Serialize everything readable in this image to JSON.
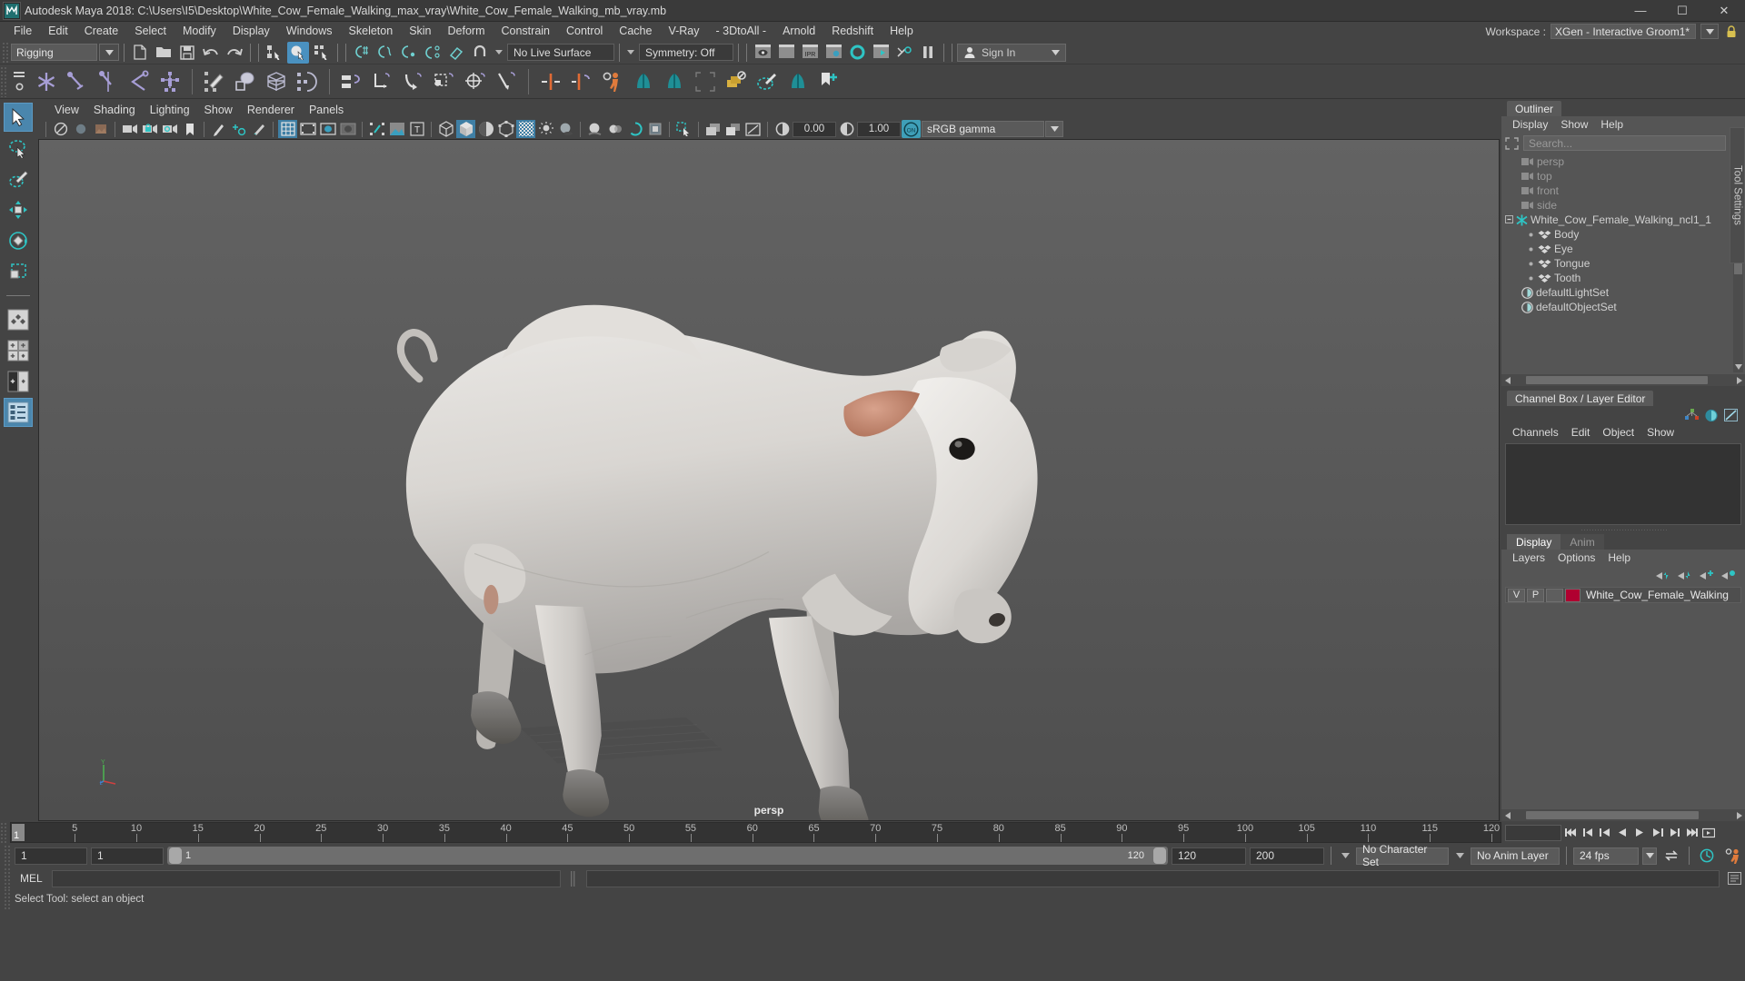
{
  "window": {
    "title": "Autodesk Maya 2018: C:\\Users\\I5\\Desktop\\White_Cow_Female_Walking_max_vray\\White_Cow_Female_Walking_mb_vray.mb",
    "minimize": "—",
    "maximize": "☐",
    "close": "✕"
  },
  "menubar": {
    "items": [
      {
        "label": "File"
      },
      {
        "label": "Edit"
      },
      {
        "label": "Create"
      },
      {
        "label": "Select"
      },
      {
        "label": "Modify"
      },
      {
        "label": "Display"
      },
      {
        "label": "Windows"
      },
      {
        "label": "Skeleton"
      },
      {
        "label": "Skin"
      },
      {
        "label": "Deform"
      },
      {
        "label": "Constrain"
      },
      {
        "label": "Control"
      },
      {
        "label": "Cache"
      },
      {
        "label": "V-Ray"
      },
      {
        "label": "- 3DtoAll -"
      },
      {
        "label": "Arnold"
      },
      {
        "label": "Redshift"
      },
      {
        "label": "Help"
      }
    ],
    "workspace_label": "Workspace :",
    "workspace_value": "XGen - Interactive Groom1*"
  },
  "statusline": {
    "menuset": "Rigging",
    "live_surface": "No Live Surface",
    "symmetry": "Symmetry: Off",
    "signin": "Sign In"
  },
  "viewport_menu": {
    "items": [
      {
        "label": "View"
      },
      {
        "label": "Shading"
      },
      {
        "label": "Lighting"
      },
      {
        "label": "Show"
      },
      {
        "label": "Renderer"
      },
      {
        "label": "Panels"
      }
    ]
  },
  "viewport_toolbar": {
    "exposure": "0.00",
    "gamma_value": "1.00",
    "color_profile": "sRGB gamma",
    "view_label": "persp"
  },
  "outliner": {
    "tab": "Outliner",
    "menu": [
      {
        "label": "Display"
      },
      {
        "label": "Show"
      },
      {
        "label": "Help"
      }
    ],
    "search_placeholder": "Search...",
    "items": [
      {
        "label": "persp",
        "icon": "camera-icon",
        "dim": true,
        "indent": 1
      },
      {
        "label": "top",
        "icon": "camera-icon",
        "dim": true,
        "indent": 1
      },
      {
        "label": "front",
        "icon": "camera-icon",
        "dim": true,
        "indent": 1
      },
      {
        "label": "side",
        "icon": "camera-icon",
        "dim": true,
        "indent": 1
      },
      {
        "label": "White_Cow_Female_Walking_ncl1_1",
        "icon": "nucleus-icon",
        "dim": false,
        "indent": 0
      },
      {
        "label": "Body",
        "icon": "mesh-icon",
        "dim": false,
        "indent": 2
      },
      {
        "label": "Eye",
        "icon": "mesh-icon",
        "dim": false,
        "indent": 2
      },
      {
        "label": "Tongue",
        "icon": "mesh-icon",
        "dim": false,
        "indent": 2
      },
      {
        "label": "Tooth",
        "icon": "mesh-icon",
        "dim": false,
        "indent": 2
      },
      {
        "label": "defaultLightSet",
        "icon": "set-icon",
        "dim": false,
        "indent": 1
      },
      {
        "label": "defaultObjectSet",
        "icon": "set-icon",
        "dim": false,
        "indent": 1
      }
    ]
  },
  "channelbox": {
    "tab": "Channel Box / Layer Editor",
    "menu": [
      {
        "label": "Channels"
      },
      {
        "label": "Edit"
      },
      {
        "label": "Object"
      },
      {
        "label": "Show"
      }
    ]
  },
  "layers": {
    "tabs": [
      {
        "label": "Display",
        "active": true
      },
      {
        "label": "Anim",
        "active": false
      }
    ],
    "menu": [
      {
        "label": "Layers"
      },
      {
        "label": "Options"
      },
      {
        "label": "Help"
      }
    ],
    "rows": [
      {
        "visible": "V",
        "playback": "P",
        "third": "",
        "color": "#b00030",
        "name": "White_Cow_Female_Walking"
      }
    ]
  },
  "tool_settings_tab": "Tool Settings",
  "timeline": {
    "ticks": [
      {
        "label": "5",
        "frame": 5
      },
      {
        "label": "10",
        "frame": 10
      },
      {
        "label": "15",
        "frame": 15
      },
      {
        "label": "20",
        "frame": 20
      },
      {
        "label": "25",
        "frame": 25
      },
      {
        "label": "30",
        "frame": 30
      },
      {
        "label": "35",
        "frame": 35
      },
      {
        "label": "40",
        "frame": 40
      },
      {
        "label": "45",
        "frame": 45
      },
      {
        "label": "50",
        "frame": 50
      },
      {
        "label": "55",
        "frame": 55
      },
      {
        "label": "60",
        "frame": 60
      },
      {
        "label": "65",
        "frame": 65
      },
      {
        "label": "70",
        "frame": 70
      },
      {
        "label": "75",
        "frame": 75
      },
      {
        "label": "80",
        "frame": 80
      },
      {
        "label": "85",
        "frame": 85
      },
      {
        "label": "90",
        "frame": 90
      },
      {
        "label": "95",
        "frame": 95
      },
      {
        "label": "100",
        "frame": 100
      },
      {
        "label": "105",
        "frame": 105
      },
      {
        "label": "110",
        "frame": 110
      },
      {
        "label": "115",
        "frame": 115
      },
      {
        "label": "120",
        "frame": 120
      }
    ],
    "current_frame": "1",
    "start": 1,
    "end": 120
  },
  "rangeslider": {
    "anim_start": "1",
    "range_start": "1",
    "bar_start_label": "1",
    "bar_end_label": "120",
    "range_end": "120",
    "anim_end": "200",
    "character_set": "No Character Set",
    "anim_layer": "No Anim Layer",
    "fps": "24 fps"
  },
  "command": {
    "language": "MEL",
    "input_value": "",
    "output_value": ""
  },
  "helpline": {
    "text": "Select Tool: select an object"
  }
}
